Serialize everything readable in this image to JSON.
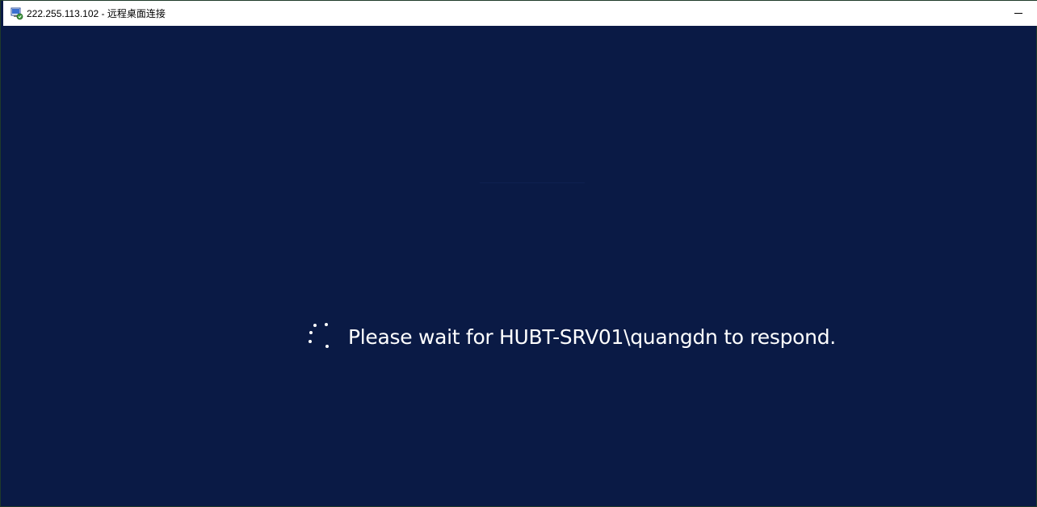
{
  "window": {
    "title": "222.255.113.102 - 远程桌面连接",
    "icon": "remote-desktop-icon",
    "minimize_icon": "minimize-icon"
  },
  "session": {
    "status_message": "Please wait for HUBT-SRV01\\quangdn to respond.",
    "spinner_icon": "loading-spinner-icon"
  },
  "colors": {
    "desktop_background": "#0a1a45",
    "titlebar_background": "#ffffff",
    "text": "#ffffff"
  }
}
